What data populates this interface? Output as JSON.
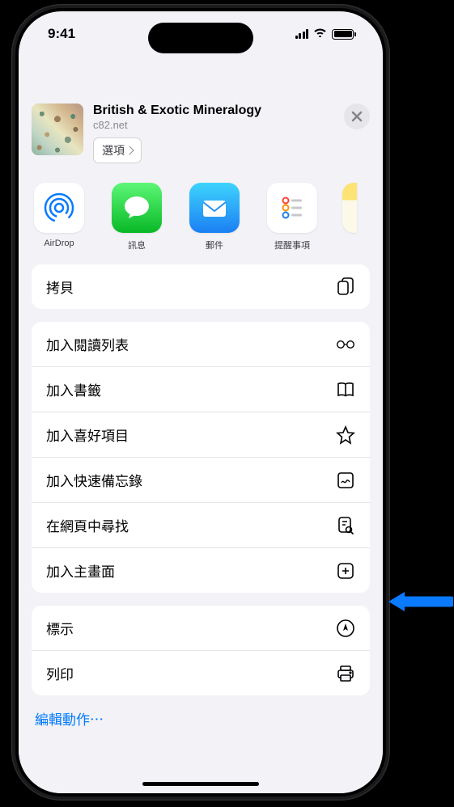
{
  "status": {
    "time": "9:41"
  },
  "header": {
    "title": "British & Exotic Mineralogy",
    "subtitle": "c82.net",
    "options_label": "選項"
  },
  "share_apps": [
    {
      "id": "airdrop",
      "label": "AirDrop"
    },
    {
      "id": "messages",
      "label": "訊息"
    },
    {
      "id": "mail",
      "label": "郵件"
    },
    {
      "id": "reminders",
      "label": "提醒事項"
    },
    {
      "id": "notes",
      "label": ""
    }
  ],
  "actions_group1": [
    {
      "id": "copy",
      "label": "拷貝",
      "icon": "copy"
    }
  ],
  "actions_group2": [
    {
      "id": "reading-list",
      "label": "加入閱讀列表",
      "icon": "glasses"
    },
    {
      "id": "bookmark",
      "label": "加入書籤",
      "icon": "book"
    },
    {
      "id": "favorite",
      "label": "加入喜好項目",
      "icon": "star"
    },
    {
      "id": "quick-note",
      "label": "加入快速備忘錄",
      "icon": "note"
    },
    {
      "id": "find",
      "label": "在網頁中尋找",
      "icon": "find"
    },
    {
      "id": "home-screen",
      "label": "加入主畫面",
      "icon": "plus-app"
    }
  ],
  "actions_group3": [
    {
      "id": "markup",
      "label": "標示",
      "icon": "markup"
    },
    {
      "id": "print",
      "label": "列印",
      "icon": "print"
    }
  ],
  "edit_actions_label": "編輯動作⋯"
}
